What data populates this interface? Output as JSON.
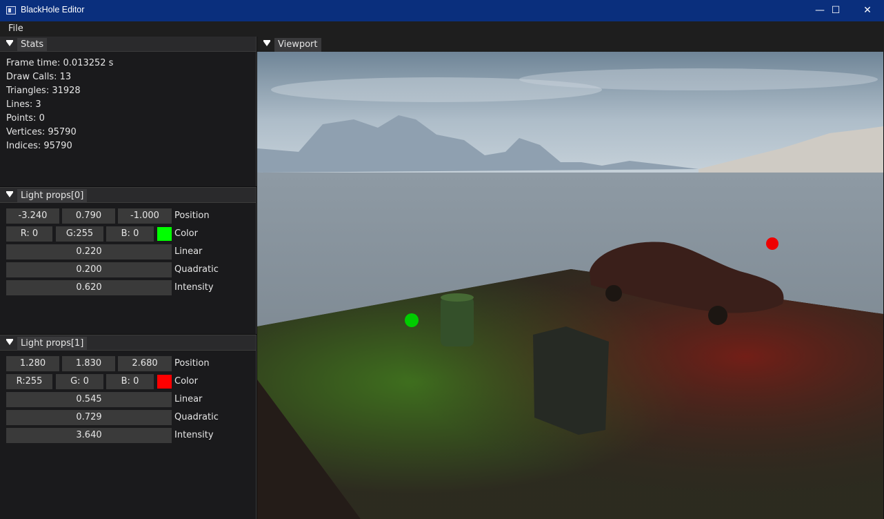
{
  "window": {
    "title": "BlackHole Editor",
    "minimize": "—",
    "maximize": "☐",
    "close": "✕"
  },
  "menu": {
    "file": "File"
  },
  "stats": {
    "tab": "Stats",
    "lines": [
      "Frame time: 0.013252 s",
      "Draw Calls: 13",
      "Triangles: 31928",
      "Lines: 3",
      "Points: 0",
      "Vertices: 95790",
      "Indices: 95790"
    ]
  },
  "light0": {
    "tab": "Light props[0]",
    "pos_x": "-3.240",
    "pos_y": "0.790",
    "pos_z": "-1.000",
    "position_label": "Position",
    "r": "R:  0",
    "g": "G:255",
    "b": "B:  0",
    "color_label": "Color",
    "color": "#00ff00",
    "linear": "0.220",
    "linear_label": "Linear",
    "quadratic": "0.200",
    "quadratic_label": "Quadratic",
    "intensity": "0.620",
    "intensity_label": "Intensity"
  },
  "light1": {
    "tab": "Light props[1]",
    "pos_x": "1.280",
    "pos_y": "1.830",
    "pos_z": "2.680",
    "position_label": "Position",
    "r": "R:255",
    "g": "G:  0",
    "b": "B:  0",
    "color_label": "Color",
    "color": "#ff0000",
    "linear": "0.545",
    "linear_label": "Linear",
    "quadratic": "0.729",
    "quadratic_label": "Quadratic",
    "intensity": "3.640",
    "intensity_label": "Intensity"
  },
  "viewport": {
    "tab": "Viewport"
  }
}
